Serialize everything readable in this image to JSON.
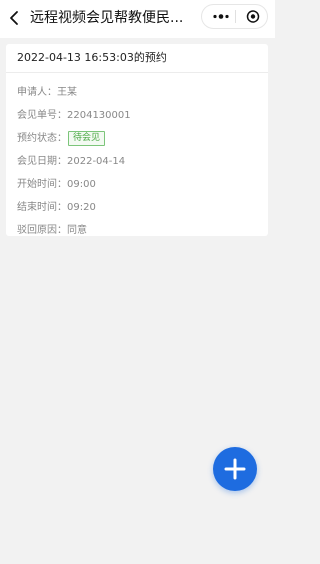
{
  "navbar": {
    "title": "远程视频会见帮教便民...",
    "back_icon": "chevron-left-icon",
    "more_icon": "more-dots-icon",
    "close_icon": "target-circle-icon"
  },
  "appointment": {
    "header": "2022-04-13 16:53:03的预约",
    "applicant_label": "申请人：",
    "applicant_value": "王某",
    "order_label": "会见单号：",
    "order_value": "2204130001",
    "status_label": "预约状态：",
    "status_value": "待会见",
    "date_label": "会见日期：",
    "date_value": "2022-04-14",
    "start_label": "开始时间：",
    "start_value": "09:00",
    "end_label": "结束时间：",
    "end_value": "09:20",
    "reject_label": "驳回原因：",
    "reject_value": "同意"
  },
  "fab": {
    "icon": "plus-icon"
  },
  "colors": {
    "accent": "#1e6ce0",
    "status_green": "#4aa844",
    "background": "#f2f2f2"
  }
}
